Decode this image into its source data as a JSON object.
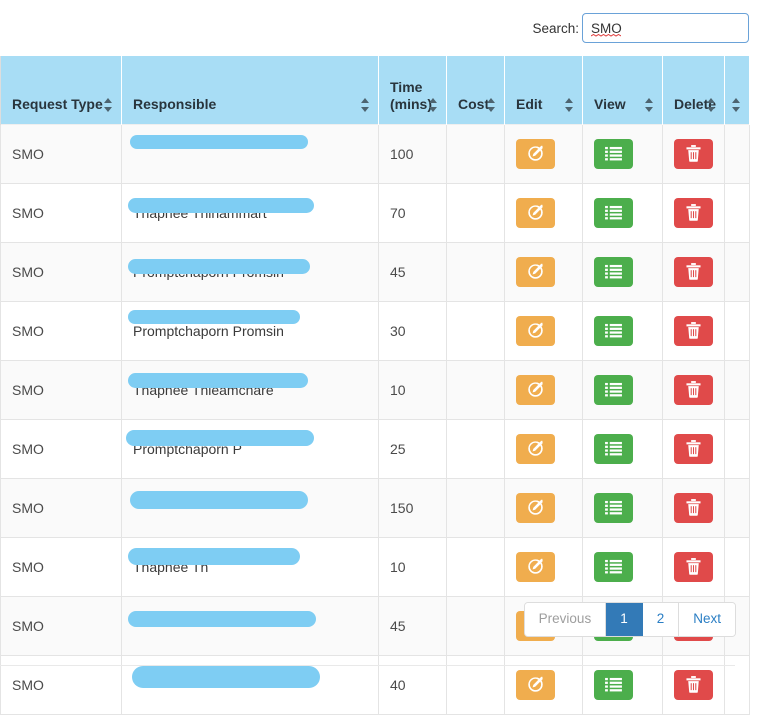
{
  "search": {
    "label": "Search:",
    "value": "SMO",
    "placeholder": ""
  },
  "table": {
    "columns": [
      {
        "label": "Request Type",
        "sortable": true
      },
      {
        "label": "Responsible",
        "sortable": true
      },
      {
        "label": "Time (mins)",
        "sortable": true
      },
      {
        "label": "Cost",
        "sortable": true
      },
      {
        "label": "Edit",
        "sortable": true
      },
      {
        "label": "View",
        "sortable": true
      },
      {
        "label": "Delete",
        "sortable": true
      },
      {
        "label": "",
        "sortable": true
      }
    ],
    "rows": [
      {
        "request_type": "SMO",
        "responsible": "",
        "time": "100",
        "cost": "",
        "edit": "edit-icon",
        "view": "list-icon",
        "delete": "trash-icon"
      },
      {
        "request_type": "SMO",
        "responsible": "Thapnee Thinammart",
        "time": "70",
        "cost": "",
        "edit": "edit-icon",
        "view": "list-icon",
        "delete": "trash-icon"
      },
      {
        "request_type": "SMO",
        "responsible": "Promptchaporn Promsin",
        "time": "45",
        "cost": "",
        "edit": "edit-icon",
        "view": "list-icon",
        "delete": "trash-icon"
      },
      {
        "request_type": "SMO",
        "responsible": "Promptchaporn Promsin",
        "time": "30",
        "cost": "",
        "edit": "edit-icon",
        "view": "list-icon",
        "delete": "trash-icon"
      },
      {
        "request_type": "SMO",
        "responsible": "Thapnee Thieamchare",
        "time": "10",
        "cost": "",
        "edit": "edit-icon",
        "view": "list-icon",
        "delete": "trash-icon"
      },
      {
        "request_type": "SMO",
        "responsible": "Promptchaporn P",
        "time": "25",
        "cost": "",
        "edit": "edit-icon",
        "view": "list-icon",
        "delete": "trash-icon"
      },
      {
        "request_type": "SMO",
        "responsible": "",
        "time": "150",
        "cost": "",
        "edit": "edit-icon",
        "view": "list-icon",
        "delete": "trash-icon"
      },
      {
        "request_type": "SMO",
        "responsible": "Thapnee Th",
        "time": "10",
        "cost": "",
        "edit": "edit-icon",
        "view": "list-icon",
        "delete": "trash-icon"
      },
      {
        "request_type": "SMO",
        "responsible": "",
        "time": "45",
        "cost": "",
        "edit": "edit-icon",
        "view": "list-icon",
        "delete": "trash-icon"
      },
      {
        "request_type": "SMO",
        "responsible": "",
        "time": "40",
        "cost": "",
        "edit": "edit-icon",
        "view": "list-icon",
        "delete": "trash-icon"
      }
    ]
  },
  "pagination": {
    "previous": "Previous",
    "pages": [
      "1",
      "2"
    ],
    "active_page": "1",
    "next": "Next"
  },
  "colors": {
    "header_bg": "#a8ddf5",
    "edit_btn": "#f0ad4e",
    "view_btn": "#4cae4c",
    "delete_btn": "#e04a4a",
    "active_page": "#337ab7",
    "redaction": "#7ecdf3"
  }
}
